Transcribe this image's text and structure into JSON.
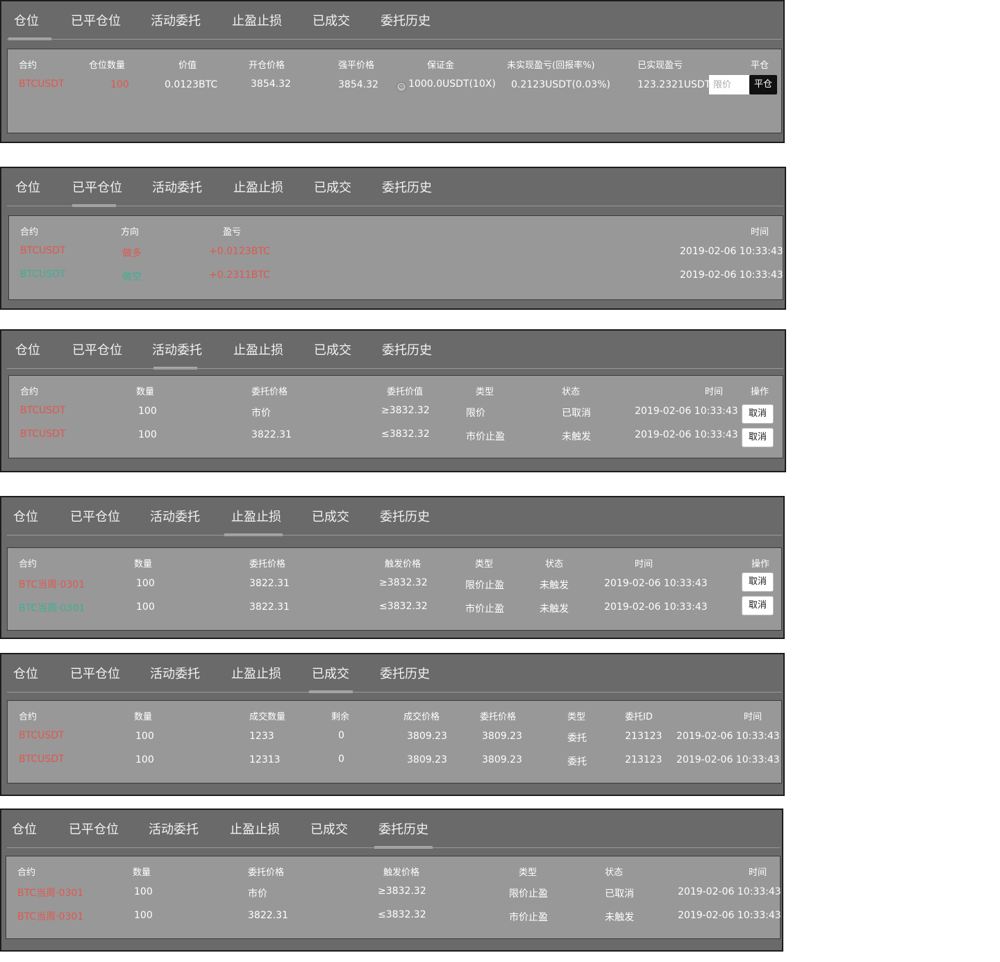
{
  "tabs": [
    "仓位",
    "已平仓位",
    "活动委托",
    "止盈止损",
    "已成交",
    "委托历史"
  ],
  "positions": {
    "headers": [
      "合约",
      "仓位数量",
      "价值",
      "开仓价格",
      "强平价格",
      "保证金",
      "未实现盈亏(回报率%)",
      "已实现盈亏",
      "平仓"
    ],
    "row": {
      "contract": "BTCUSDT",
      "qty": "100",
      "value": "0.0123BTC",
      "open_price": "3854.32",
      "liq_price": "3854.32",
      "margin": "1000.0USDT(10X)",
      "unrealized": "0.2123USDT(0.03%)",
      "realized": "123.2321USDT",
      "limit_placeholder": "限价",
      "close_label": "平仓"
    }
  },
  "closed": {
    "headers": [
      "合约",
      "方向",
      "盈亏",
      "时间"
    ],
    "rows": [
      {
        "contract": "BTCUSDT",
        "side": "做多",
        "pnl": "+0.0123BTC",
        "time": "2019-02-06 10:33:43"
      },
      {
        "contract": "BTCUSDT",
        "side": "做空",
        "pnl": "+0.2311BTC",
        "time": "2019-02-06 10:33:43"
      }
    ]
  },
  "active": {
    "headers": [
      "合约",
      "数量",
      "委托价格",
      "委托价值",
      "类型",
      "状态",
      "时间",
      "操作"
    ],
    "rows": [
      {
        "contract": "BTCUSDT",
        "qty": "100",
        "price": "市价",
        "value": "≥3832.32",
        "type": "限价",
        "status": "已取消",
        "time": "2019-02-06 10:33:43",
        "action": "取消"
      },
      {
        "contract": "BTCUSDT",
        "qty": "100",
        "price": "3822.31",
        "value": "≤3832.32",
        "type": "市价止盈",
        "status": "未触发",
        "time": "2019-02-06 10:33:43",
        "action": "取消"
      }
    ]
  },
  "tpsl": {
    "headers": [
      "合约",
      "数量",
      "委托价格",
      "触发价格",
      "类型",
      "状态",
      "时间",
      "操作"
    ],
    "rows": [
      {
        "contract": "BTC当周·0301",
        "qty": "100",
        "price": "3822.31",
        "trigger": "≥3832.32",
        "type": "限价止盈",
        "status": "未触发",
        "time": "2019-02-06 10:33:43",
        "action": "取消"
      },
      {
        "contract": "BTC当周·0301",
        "qty": "100",
        "price": "3822.31",
        "trigger": "≤3832.32",
        "type": "市价止盈",
        "status": "未触发",
        "time": "2019-02-06 10:33:43",
        "action": "取消"
      }
    ]
  },
  "filled": {
    "headers": [
      "合约",
      "数量",
      "成交数量",
      "剩余",
      "成交价格",
      "委托价格",
      "类型",
      "委托ID",
      "时间"
    ],
    "rows": [
      {
        "contract": "BTCUSDT",
        "qty": "100",
        "filled_qty": "1233",
        "remain": "0",
        "fill_price": "3809.23",
        "order_price": "3809.23",
        "type": "委托",
        "id": "213123",
        "time": "2019-02-06 10:33:43"
      },
      {
        "contract": "BTCUSDT",
        "qty": "100",
        "filled_qty": "12313",
        "remain": "0",
        "fill_price": "3809.23",
        "order_price": "3809.23",
        "type": "委托",
        "id": "213123",
        "time": "2019-02-06 10:33:43"
      }
    ]
  },
  "history": {
    "headers": [
      "合约",
      "数量",
      "委托价格",
      "触发价格",
      "类型",
      "状态",
      "时间"
    ],
    "rows": [
      {
        "contract": "BTC当周·0301",
        "qty": "100",
        "price": "市价",
        "trigger": "≥3832.32",
        "type": "限价止盈",
        "status": "已取消",
        "time": "2019-02-06 10:33:43"
      },
      {
        "contract": "BTC当周·0301",
        "qty": "100",
        "price": "3822.31",
        "trigger": "≤3832.32",
        "type": "市价止盈",
        "status": "未触发",
        "time": "2019-02-06 10:33:43"
      }
    ]
  },
  "colors": {
    "long": "#e0574f",
    "short": "#3fae93",
    "panel": "#6a6a6a",
    "inner": "#989898"
  }
}
